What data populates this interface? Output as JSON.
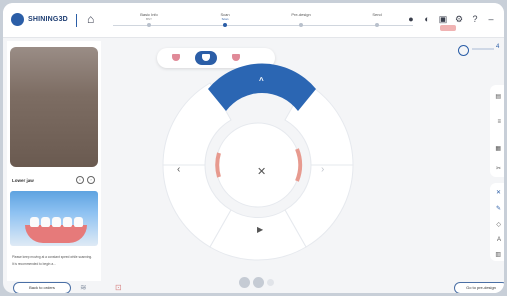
{
  "app": {
    "brand": "SHINING3D"
  },
  "steps": [
    {
      "label": "Basic Info",
      "sub": "BSY",
      "active": false
    },
    {
      "label": "Scan",
      "sub": "Scan",
      "active": true
    },
    {
      "label": "Pre-design",
      "sub": "",
      "active": false
    },
    {
      "label": "Send",
      "sub": "",
      "active": false
    }
  ],
  "left_panel": {
    "title": "Lower jaw",
    "notes": [
      "Please keep moving at a constant speed while scanning.",
      "It is recommended to begin a..."
    ]
  },
  "right_panel": {
    "top_label": "4"
  },
  "bottom": {
    "back_label": "Back to orders",
    "next_label": "Go to pre-design"
  },
  "colors": {
    "accent": "#2b5ea7",
    "gum": "#e67a7a"
  }
}
